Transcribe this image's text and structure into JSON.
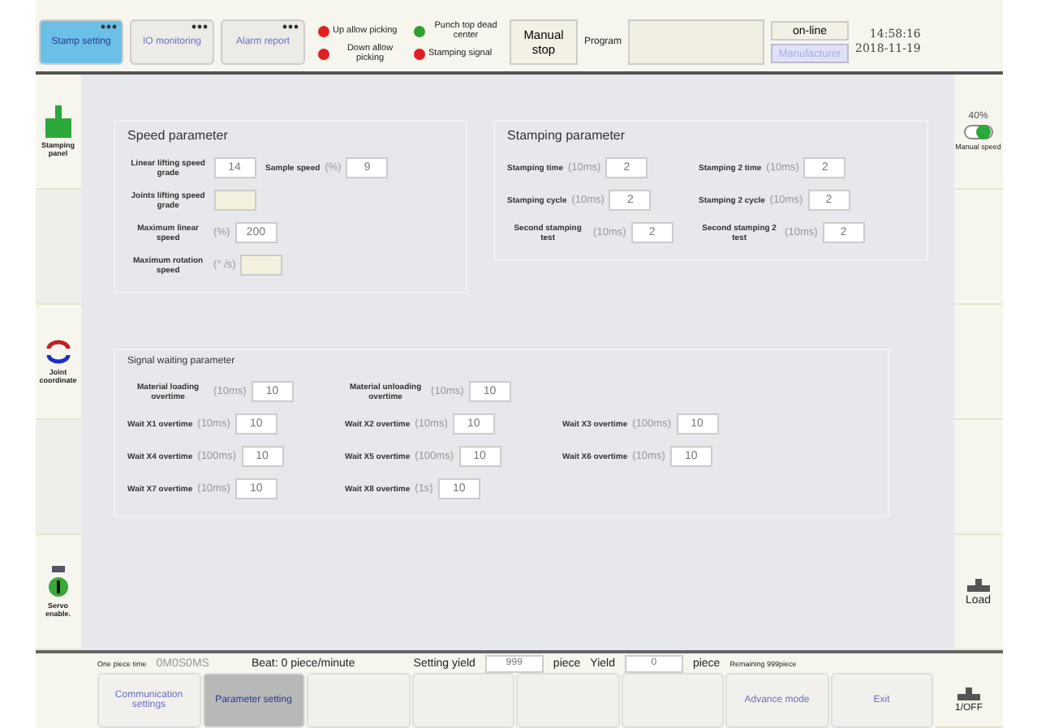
{
  "header": {
    "tabs": [
      {
        "label": "Stamp setting",
        "selected": true
      },
      {
        "label": "IO monitoring",
        "selected": false
      },
      {
        "label": "Alarm report",
        "selected": false
      }
    ],
    "signals": [
      {
        "label": "Up allow picking",
        "color": "#e02020"
      },
      {
        "label": "Punch top dead center",
        "color": "#30a030"
      },
      {
        "label": "Down allow picking",
        "color": "#e02020"
      },
      {
        "label": "Stamping signal",
        "color": "#e02020"
      }
    ],
    "manual_stop": "Manual stop",
    "program_label": "Program",
    "mode": "on-line",
    "manufacturer": "Manufacturer",
    "time": "14:58:16",
    "date": "2018-11-19"
  },
  "left_sidebar": [
    {
      "kind": "stamping",
      "label": "Stamping panel"
    },
    {
      "kind": "blank"
    },
    {
      "kind": "joint",
      "label": "Joint coordinate"
    },
    {
      "kind": "blank"
    },
    {
      "kind": "servo",
      "label": "Servo enable."
    }
  ],
  "right_sidebar": {
    "speed": "40%",
    "speed_label": "Manual speed",
    "load": "Load",
    "io": "1/OFF"
  },
  "speed_parameter": {
    "title": "Speed parameter",
    "rows": [
      [
        {
          "label": "Linear lifting speed grade",
          "value": "14"
        },
        {
          "label": "Sample speed",
          "unit": "(%)",
          "value": "9"
        }
      ],
      [
        {
          "label": "Joints lifting speed grade"
        }
      ],
      [
        {
          "label": "Maximum linear speed",
          "unit": "(%)",
          "value": "200"
        }
      ],
      [
        {
          "label": "Maximum rotation speed",
          "unit": "(° /s)"
        }
      ]
    ]
  },
  "stamping_parameter": {
    "title": "Stamping parameter",
    "rows": [
      [
        {
          "label": "Stamping time",
          "unit": "(10ms)",
          "value": "2"
        },
        {
          "label": "Stamping 2 time",
          "unit": "(10ms)",
          "value": "2"
        }
      ],
      [
        {
          "label": "Stamping cycle",
          "unit": "(10ms)",
          "value": "2"
        },
        {
          "label": "Stamping 2 cycle",
          "unit": "(10ms)",
          "value": "2"
        }
      ],
      [
        {
          "label": "Second stamping test",
          "unit": "(10ms)",
          "value": "2"
        },
        {
          "label": "Second stamping 2 test",
          "unit": "(10ms)",
          "value": "2"
        }
      ]
    ]
  },
  "signal_waiting_parameter": {
    "title": "Signal waiting parameter",
    "rows": [
      [
        {
          "label": "Material loading overtime",
          "unit": "(10ms)",
          "value": "10"
        },
        {
          "label": "Material unloading overtime",
          "unit": "(10ms)",
          "value": "10"
        }
      ],
      [
        {
          "label": "Wait X1 overtime",
          "unit": "(10ms)",
          "value": "10"
        },
        {
          "label": "Wait X2 overtime",
          "unit": "(10ms)",
          "value": "10"
        },
        {
          "label": "Wait X3 overtime",
          "unit": "(100ms)",
          "value": "10"
        }
      ],
      [
        {
          "label": "Wait X4 overtime",
          "unit": "(100ms)",
          "value": "10"
        },
        {
          "label": "Wait X5 overtime",
          "unit": "(100ms)",
          "value": "10"
        },
        {
          "label": "Wait X6 overtime",
          "unit": "(10ms)",
          "value": "10"
        }
      ],
      [
        {
          "label": "Wait X7 overtime",
          "unit": "(10ms)",
          "value": "10"
        },
        {
          "label": "Wait X8 overtime",
          "unit": "(1s)",
          "value": "10"
        }
      ]
    ]
  },
  "status": {
    "piece_time_label": "One piece time",
    "piece_time": "0M0S0MS",
    "beat": "Beat: 0 piece/minute",
    "setting_yield_label": "Setting yield",
    "setting_yield": "999",
    "setting_unit": "piece",
    "yield_label": "Yield",
    "yield": "0",
    "yield_unit": "piece",
    "remaining": "Remaining 999piece"
  },
  "bottom_buttons": [
    {
      "label": "Communication settings",
      "selected": false
    },
    {
      "label": "Parameter setting",
      "selected": true
    },
    {
      "selected": false
    },
    {
      "selected": false
    },
    {
      "selected": false
    },
    {
      "selected": false
    },
    {
      "label": "Advance mode",
      "selected": false
    },
    {
      "label": "Exit",
      "selected": false
    }
  ]
}
